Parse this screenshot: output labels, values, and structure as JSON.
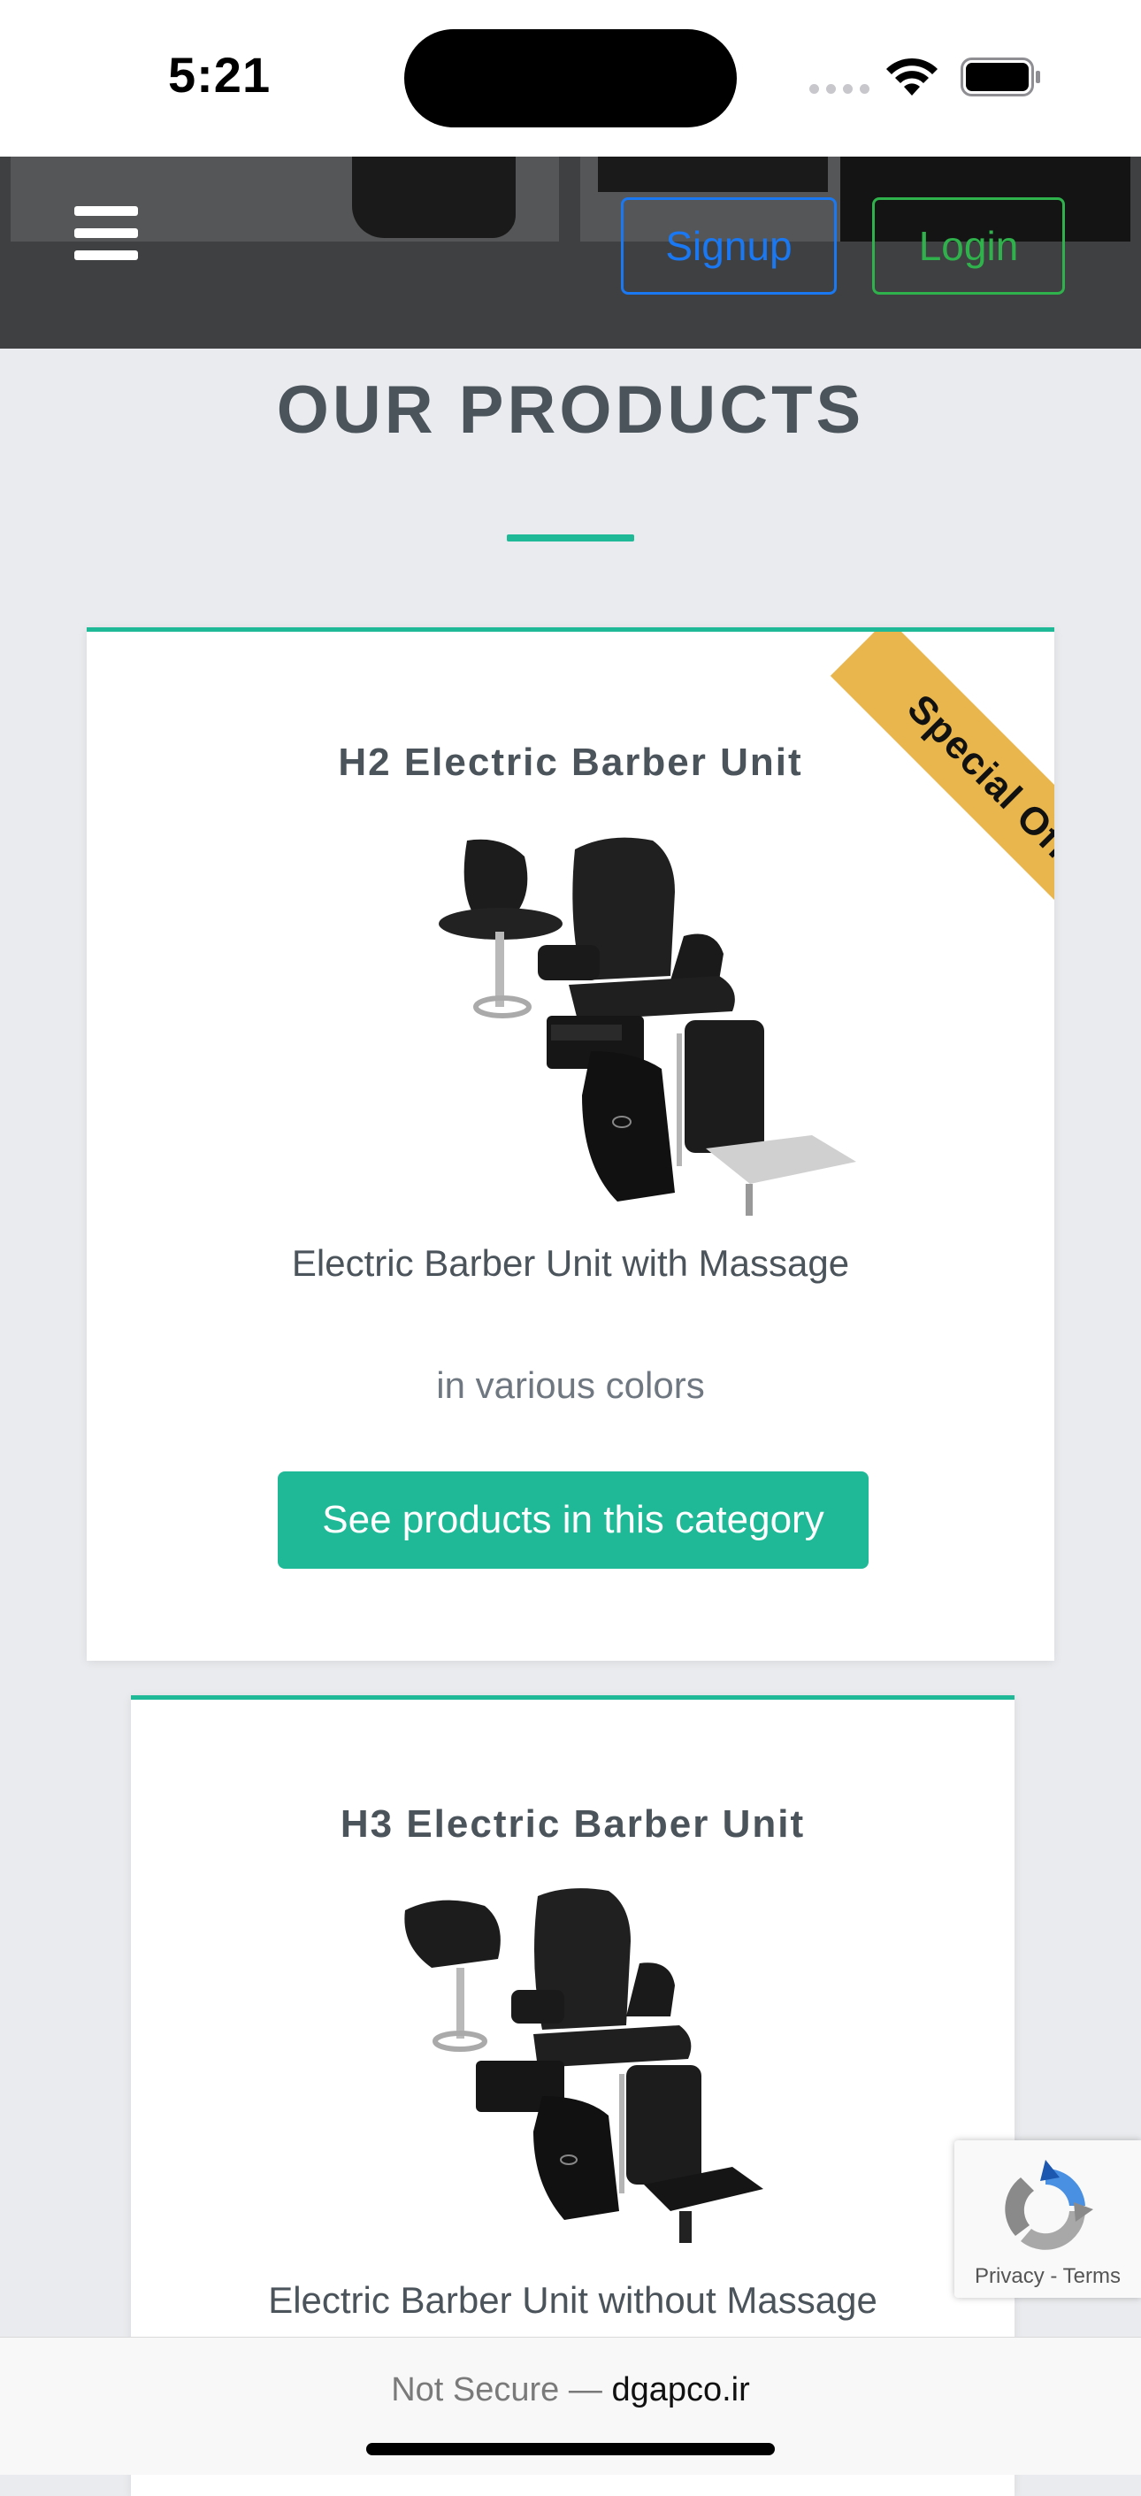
{
  "status_bar": {
    "time": "5:21"
  },
  "header": {
    "signup_label": "Signup",
    "login_label": "Login",
    "signup_color": "#1a78f2",
    "login_color": "#2fb14b",
    "background": "#3f4041"
  },
  "section": {
    "title": "OUR PRODUCTS",
    "accent_color": "#1fb997"
  },
  "products": [
    {
      "title": "H2 Electric Barber Unit",
      "description": "Electric Barber Unit with Massage",
      "subtitle": "in various colors",
      "button_label": "See products in this category",
      "ribbon": "Special Offer",
      "ribbon_color": "#e8b64c",
      "image_icon": "barber-chair-image"
    },
    {
      "title": "H3 Electric Barber Unit",
      "description": "Electric Barber Unit without Massage",
      "image_icon": "barber-chair-image"
    }
  ],
  "recaptcha": {
    "links": "Privacy - Terms"
  },
  "browser_bar": {
    "security_label": "Not Secure —",
    "domain": "dgapco.ir"
  }
}
